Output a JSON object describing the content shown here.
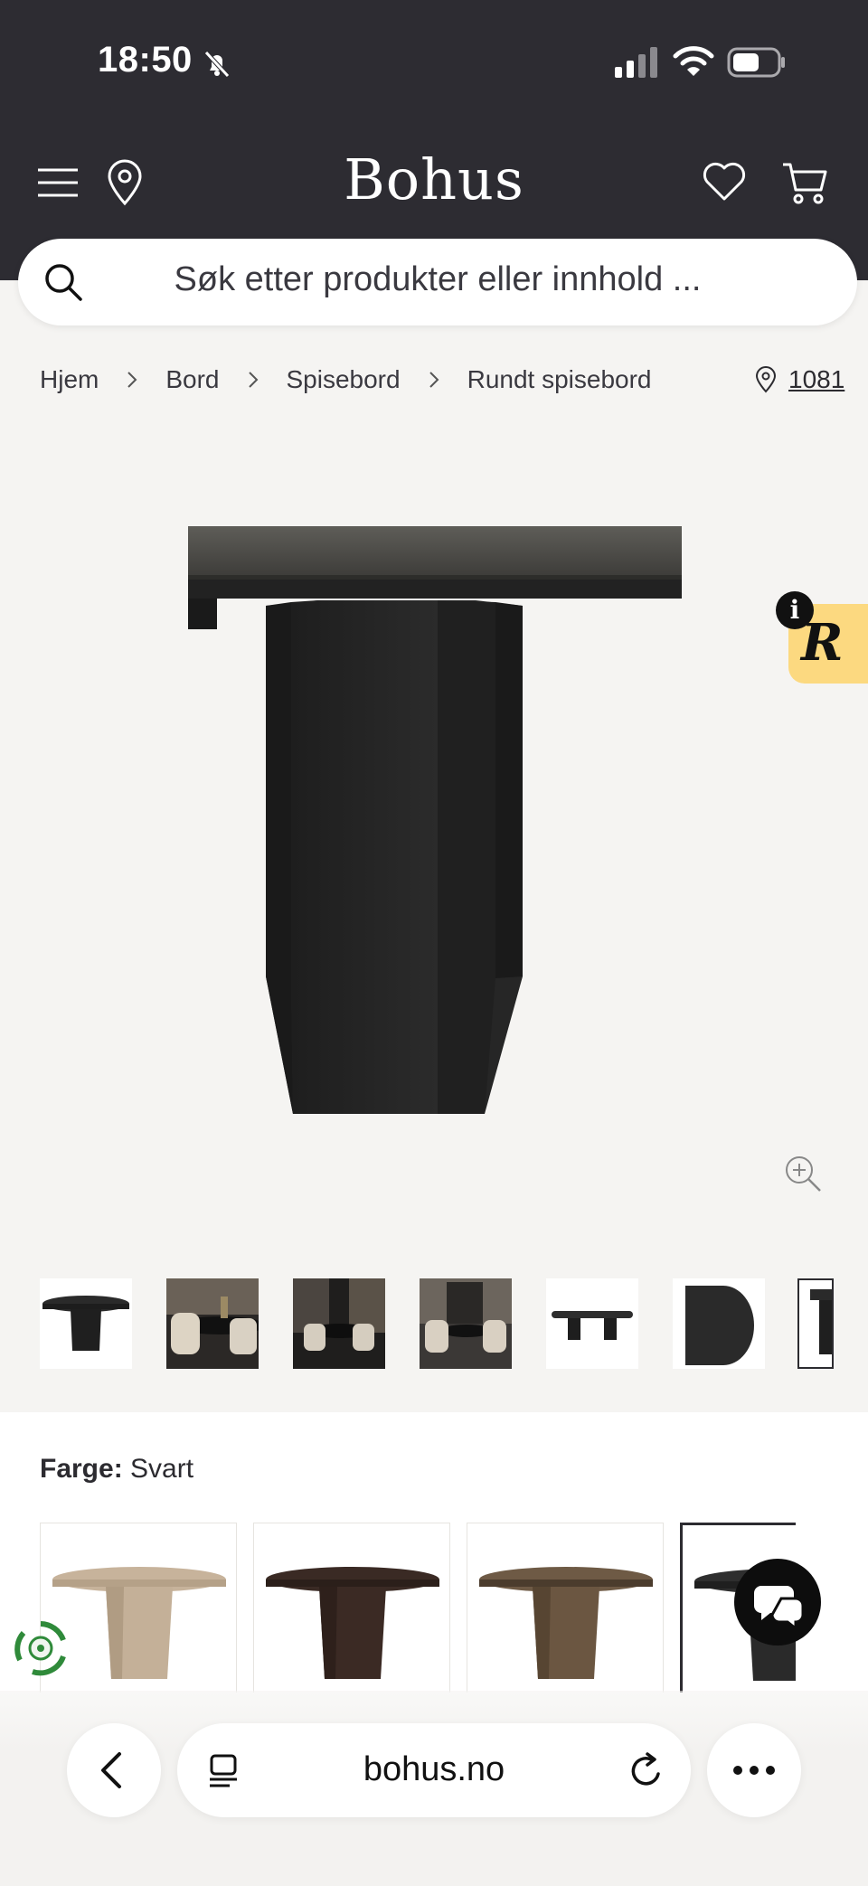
{
  "status_bar": {
    "time": "18:50"
  },
  "header": {
    "logo": "Bohus"
  },
  "search": {
    "placeholder": "Søk etter produkter eller innhold ..."
  },
  "breadcrumb": [
    "Hjem",
    "Bord",
    "Spisebord",
    "Rundt spisebord"
  ],
  "location": {
    "postal_code": "1081"
  },
  "badge": {
    "letter": "R",
    "info": "i"
  },
  "product": {
    "thumbnail_count": 7,
    "color_label": "Farge:",
    "color_value": "Svart",
    "variant_colors": [
      "#c9b59c",
      "#3b2a24",
      "#6b5641",
      "#2a2a2a"
    ],
    "selected_variant": 3
  },
  "browser": {
    "url": "bohus.no"
  }
}
